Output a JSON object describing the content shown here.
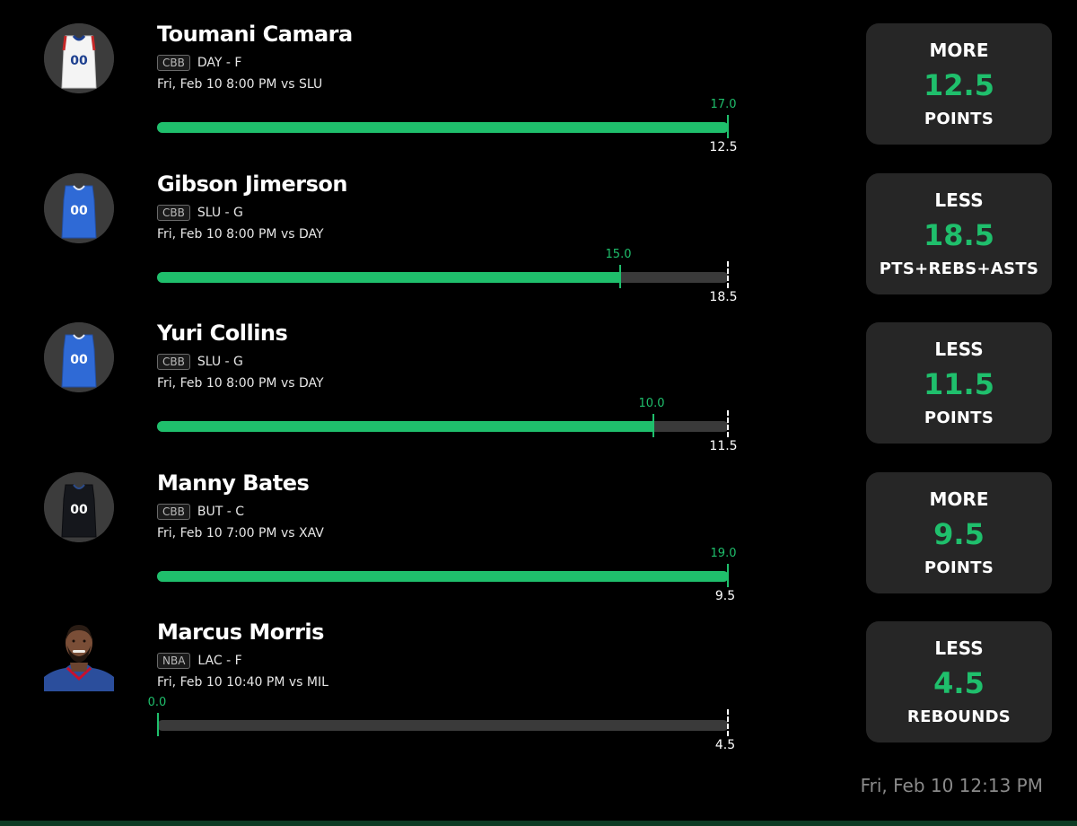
{
  "entries": [
    {
      "name": "Toumani Camara",
      "league": "CBB",
      "team_pos": "DAY - F",
      "game": "Fri, Feb 10 8:00 PM  vs SLU",
      "actual": "17.0",
      "line": "12.5",
      "progress": 1.0,
      "pick": {
        "direction": "MORE",
        "value": "12.5",
        "stat": "POINTS"
      },
      "avatar": "jersey-white-icon"
    },
    {
      "name": "Gibson Jimerson",
      "league": "CBB",
      "team_pos": "SLU - G",
      "game": "Fri, Feb 10 8:00 PM  vs DAY",
      "actual": "15.0",
      "line": "18.5",
      "progress": 0.811,
      "pick": {
        "direction": "LESS",
        "value": "18.5",
        "stat": "PTS+REBS+ASTS"
      },
      "avatar": "jersey-blue-icon"
    },
    {
      "name": "Yuri Collins",
      "league": "CBB",
      "team_pos": "SLU - G",
      "game": "Fri, Feb 10 8:00 PM  vs DAY",
      "actual": "10.0",
      "line": "11.5",
      "progress": 0.87,
      "pick": {
        "direction": "LESS",
        "value": "11.5",
        "stat": "POINTS"
      },
      "avatar": "jersey-blue-icon"
    },
    {
      "name": "Manny Bates",
      "league": "CBB",
      "team_pos": "BUT - C",
      "game": "Fri, Feb 10 7:00 PM  vs XAV",
      "actual": "19.0",
      "line": "9.5",
      "progress": 1.0,
      "pick": {
        "direction": "MORE",
        "value": "9.5",
        "stat": "POINTS"
      },
      "avatar": "jersey-black-icon"
    },
    {
      "name": "Marcus Morris",
      "league": "NBA",
      "team_pos": "LAC - F",
      "game": "Fri, Feb 10 10:40 PM  vs MIL",
      "actual": "0.0",
      "line": "4.5",
      "progress": 0.0,
      "pick": {
        "direction": "LESS",
        "value": "4.5",
        "stat": "REBOUNDS"
      },
      "avatar": "player-photo"
    }
  ],
  "timestamp": "Fri, Feb 10 12:13 PM",
  "colors": {
    "accent": "#1fbf6c",
    "card_bg": "#262626",
    "track_bg": "#3a3a3a",
    "timestamp": "#8a8a8a"
  }
}
